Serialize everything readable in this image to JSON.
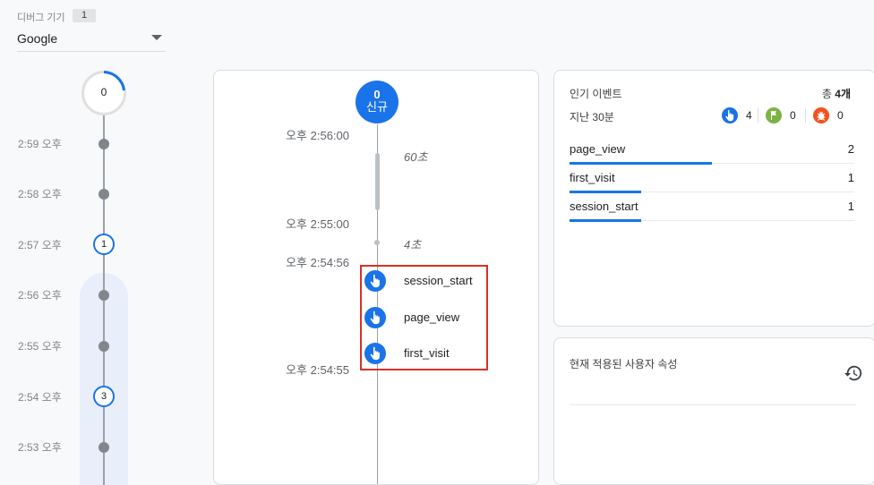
{
  "device": {
    "label": "디버그 기기",
    "count": "1",
    "selected": "Google"
  },
  "left_timeline": {
    "top_count": "0",
    "minutes": [
      {
        "time": "2:59 오후",
        "count": ""
      },
      {
        "time": "2:58 오후",
        "count": ""
      },
      {
        "time": "2:57 오후",
        "count": "1"
      },
      {
        "time": "2:56 오후",
        "count": ""
      },
      {
        "time": "2:55 오후",
        "count": ""
      },
      {
        "time": "2:54 오후",
        "count": "3"
      },
      {
        "time": "2:53 오후",
        "count": ""
      }
    ]
  },
  "stream": {
    "new_count": "0",
    "new_label": "신규",
    "timestamps": [
      "오후 2:56:00",
      "오후 2:55:00",
      "오후 2:54:56",
      "오후 2:54:55"
    ],
    "durations": [
      "60초",
      "4초"
    ],
    "events": [
      "session_start",
      "page_view",
      "first_visit"
    ]
  },
  "top_events": {
    "title": "인기 이벤트",
    "total_prefix": "총",
    "total_value": "4개",
    "period": "지난 30분",
    "counts": [
      {
        "icon": "touch-event-icon",
        "value": "4",
        "color": "#1a73e8"
      },
      {
        "icon": "conversion-flag-icon",
        "value": "0",
        "color": "#7cb342"
      },
      {
        "icon": "error-bug-icon",
        "value": "0",
        "color": "#f4511e"
      }
    ],
    "rows": [
      {
        "name": "page_view",
        "count": "2",
        "share": 0.5
      },
      {
        "name": "first_visit",
        "count": "1",
        "share": 0.25
      },
      {
        "name": "session_start",
        "count": "1",
        "share": 0.25
      }
    ]
  },
  "user_props": {
    "title": "현재 적용된 사용자 속성",
    "history_icon": "history-icon"
  }
}
